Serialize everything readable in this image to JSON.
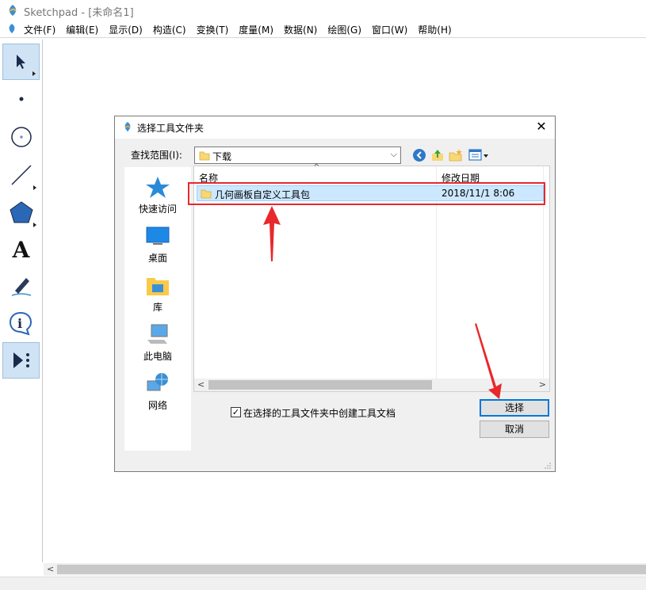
{
  "app": {
    "title": "Sketchpad  - [未命名1]",
    "menu": [
      "文件(F)",
      "编辑(E)",
      "显示(D)",
      "构造(C)",
      "变换(T)",
      "度量(M)",
      "数据(N)",
      "绘图(G)",
      "窗口(W)",
      "帮助(H)"
    ]
  },
  "toolbox": {
    "tools": [
      "arrow-select-tool",
      "point-tool",
      "compass-tool",
      "straightedge-tool",
      "polygon-tool",
      "text-tool",
      "marker-tool",
      "information-tool",
      "custom-tools"
    ],
    "text_tool_glyph": "A"
  },
  "dialog": {
    "title": "选择工具文件夹",
    "lookin_label": "查找范围(I):",
    "lookin_value": "下载",
    "places": [
      "快速访问",
      "桌面",
      "库",
      "此电脑",
      "网络"
    ],
    "columns": {
      "name": "名称",
      "date": "修改日期"
    },
    "files": [
      {
        "name": "几何画板自定义工具包",
        "date": "2018/11/1 8:06"
      }
    ],
    "checkbox": {
      "checked": true,
      "label": "在选择的工具文件夹中创建工具文档"
    },
    "buttons": {
      "select": "选择",
      "cancel": "取消"
    }
  },
  "colors": {
    "annotation_red": "#e8282b",
    "selection_blue": "#cce8ff",
    "folder_yellow": "#f8d775"
  }
}
